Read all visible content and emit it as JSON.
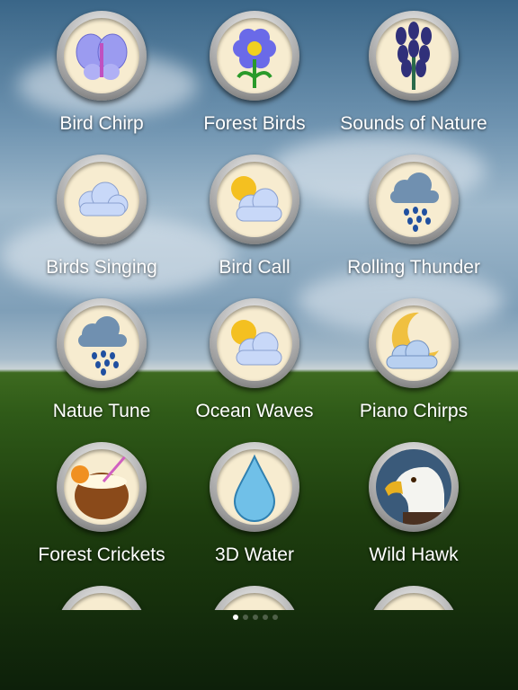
{
  "items": [
    {
      "label": "Bird Chirp",
      "icon": "butterfly-icon"
    },
    {
      "label": "Forest Birds",
      "icon": "flower-icon"
    },
    {
      "label": "Sounds of Nature",
      "icon": "bluebell-icon"
    },
    {
      "label": "Birds Singing",
      "icon": "cloud-icon"
    },
    {
      "label": "Bird Call",
      "icon": "sun-cloud-icon"
    },
    {
      "label": "Rolling Thunder",
      "icon": "rain-cloud-icon"
    },
    {
      "label": "Natue Tune",
      "icon": "rain-cloud-icon"
    },
    {
      "label": "Ocean Waves",
      "icon": "sun-cloud-icon"
    },
    {
      "label": "Piano Chirps",
      "icon": "moon-cloud-icon"
    },
    {
      "label": "Forest Crickets",
      "icon": "coconut-drink-icon"
    },
    {
      "label": "3D Water",
      "icon": "water-drop-icon"
    },
    {
      "label": "Wild Hawk",
      "icon": "eagle-icon"
    },
    {
      "label": "",
      "icon": "blue-shape-icon"
    },
    {
      "label": "",
      "icon": "purple-flower-icon"
    },
    {
      "label": "",
      "icon": "green-bubbles-icon"
    }
  ],
  "pagination": {
    "pages": 5,
    "current": 1
  }
}
